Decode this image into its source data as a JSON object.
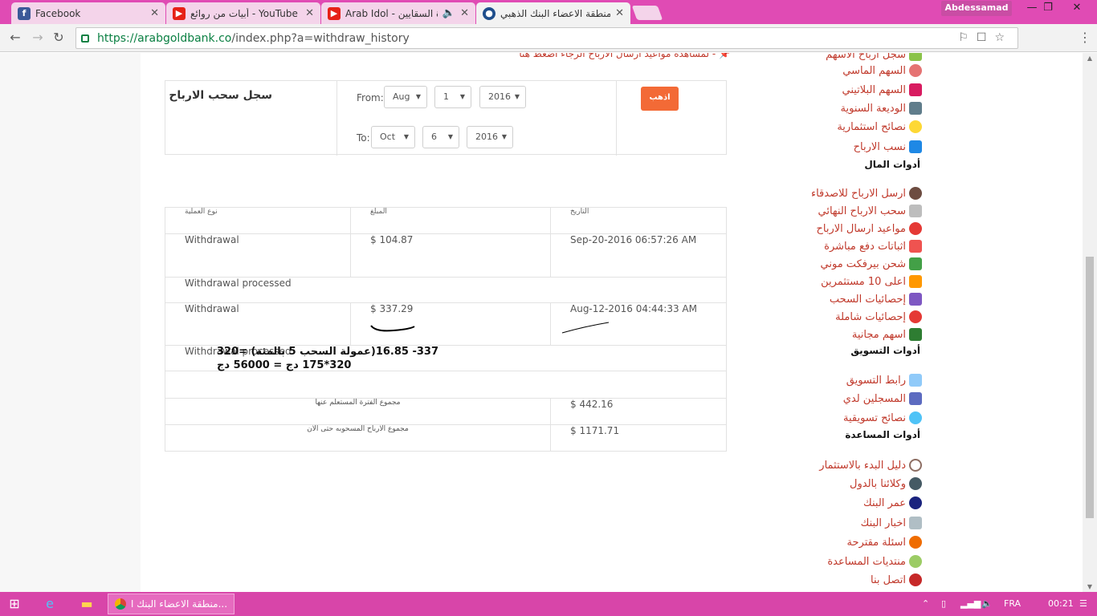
{
  "browser": {
    "tabs": [
      {
        "title": "Facebook",
        "icon": "facebook-icon",
        "color": "#3b5998"
      },
      {
        "title": "أبيات من روائع - YouTube",
        "icon": "youtube-icon",
        "color": "#e62117"
      },
      {
        "title": "Arab Idol - قرة السقايين",
        "icon": "youtube-icon",
        "color": "#e62117"
      },
      {
        "title": "منطقة الاعضاء البنك الذهبي",
        "icon": "bank-icon",
        "color": "#1f4e8c"
      }
    ],
    "user": "Abdessamad",
    "url_host": "https://arabgoldbank.co",
    "url_path": "/index.php?a=withdraw_history"
  },
  "page": {
    "top_note": "- لمشاهدة مواعيد ارسال الارباح الرجاء اضغط هنا",
    "filter": {
      "title": "سجل سحب الارباح",
      "from_label": "From:",
      "to_label": "To:",
      "from_month": "Aug",
      "from_day": "1",
      "from_year": "2016",
      "to_month": "Oct",
      "to_day": "6",
      "to_year": "2016",
      "go_label": "اذهب"
    },
    "table": {
      "headers": [
        "نوع العملية",
        "المبلغ",
        "التاريخ"
      ],
      "rows": [
        {
          "type": "Withdrawal",
          "amount": "$ 104.87",
          "date": "Sep-20-2016 06:57:26 AM",
          "status": "Withdrawal processed"
        },
        {
          "type": "Withdrawal",
          "amount": "$ 337.29",
          "date": "Aug-12-2016 04:44:33 AM",
          "status": "Withdrawal processed"
        }
      ],
      "period_total_label": "مجموع الفترة المستعلم عنها",
      "period_total": "$ 442.16",
      "all_total_label": "مجموع الارباح المسحوبه حتى الان",
      "all_total": "$ 1171.71"
    },
    "annotation": {
      "line1": "337- 16.85(عمولة السحب 5 بالمئة) =320",
      "line2": "320*175 دج = 56000 دج"
    }
  },
  "sidebar": {
    "items_top": [
      {
        "label": "سجل ارباح الاسهم",
        "icon": "chart-icon"
      },
      {
        "label": "السهم الماسي",
        "icon": "diamond-icon"
      },
      {
        "label": "السهم البلاتيني",
        "icon": "platinum-icon"
      },
      {
        "label": "الوديعة السنوية",
        "icon": "safe-icon"
      },
      {
        "label": "نصائح استثمارية",
        "icon": "bulb-icon"
      },
      {
        "label": "نسب الارباح",
        "icon": "graph-icon"
      }
    ],
    "heading_money": "أدوات المال",
    "items_money": [
      {
        "label": "ارسل الارباح للاصدقاء",
        "icon": "user-icon"
      },
      {
        "label": "سحب الارباح النهائي",
        "icon": "atm-icon"
      },
      {
        "label": "مواعيد ارسال الارباح",
        "icon": "clock-icon"
      },
      {
        "label": "اثباتات دفع مباشرة",
        "icon": "proof-icon"
      },
      {
        "label": "شحن بيرفكت موني",
        "icon": "dollar-icon"
      },
      {
        "label": "اعلى 10 مستثمرين",
        "icon": "people-icon"
      },
      {
        "label": "إحصائيات السحب",
        "icon": "stats-icon"
      },
      {
        "label": "إحصائيات شاملة",
        "icon": "pie-icon"
      },
      {
        "label": "اسهم مجانية",
        "icon": "gift-icon"
      }
    ],
    "heading_marketing": "أدوات التسويق",
    "items_marketing": [
      {
        "label": "رابط التسويق",
        "icon": "link-icon"
      },
      {
        "label": "المسجلين لدي",
        "icon": "group-icon"
      },
      {
        "label": "نصائح تسويقية",
        "icon": "tips-icon"
      }
    ],
    "heading_help": "أدوات المساعدة",
    "items_help": [
      {
        "label": "دليل البدء بالاستثمار",
        "icon": "guide-icon"
      },
      {
        "label": "وكلائنا بالدول",
        "icon": "agent-icon"
      },
      {
        "label": "عمر البنك",
        "icon": "hourglass-icon"
      },
      {
        "label": "اخبار البنك",
        "icon": "news-icon"
      },
      {
        "label": "اسئلة مقترحة",
        "icon": "question-icon"
      },
      {
        "label": "منتديات المساعدة",
        "icon": "help-icon"
      },
      {
        "label": "اتصل بنا",
        "icon": "phone-icon"
      }
    ]
  },
  "taskbar": {
    "task": "منطقة الاعضاء البنك ا...",
    "lang": "FRA",
    "time": "00:21"
  }
}
